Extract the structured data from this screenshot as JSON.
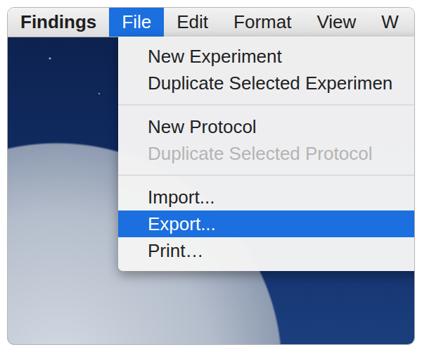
{
  "menubar": {
    "app_name": "Findings",
    "menus": [
      {
        "label": "File",
        "selected": true
      },
      {
        "label": "Edit",
        "selected": false
      },
      {
        "label": "Format",
        "selected": false
      },
      {
        "label": "View",
        "selected": false
      },
      {
        "label": "W",
        "selected": false
      }
    ]
  },
  "file_menu": {
    "groups": [
      [
        {
          "label": "New Experiment",
          "disabled": false,
          "selected": false
        },
        {
          "label": "Duplicate Selected Experimen",
          "disabled": false,
          "selected": false
        }
      ],
      [
        {
          "label": "New Protocol",
          "disabled": false,
          "selected": false
        },
        {
          "label": "Duplicate Selected Protocol",
          "disabled": true,
          "selected": false
        }
      ],
      [
        {
          "label": "Import...",
          "disabled": false,
          "selected": false
        },
        {
          "label": "Export...",
          "disabled": false,
          "selected": true
        },
        {
          "label": "Print…",
          "disabled": false,
          "selected": false
        }
      ]
    ]
  }
}
